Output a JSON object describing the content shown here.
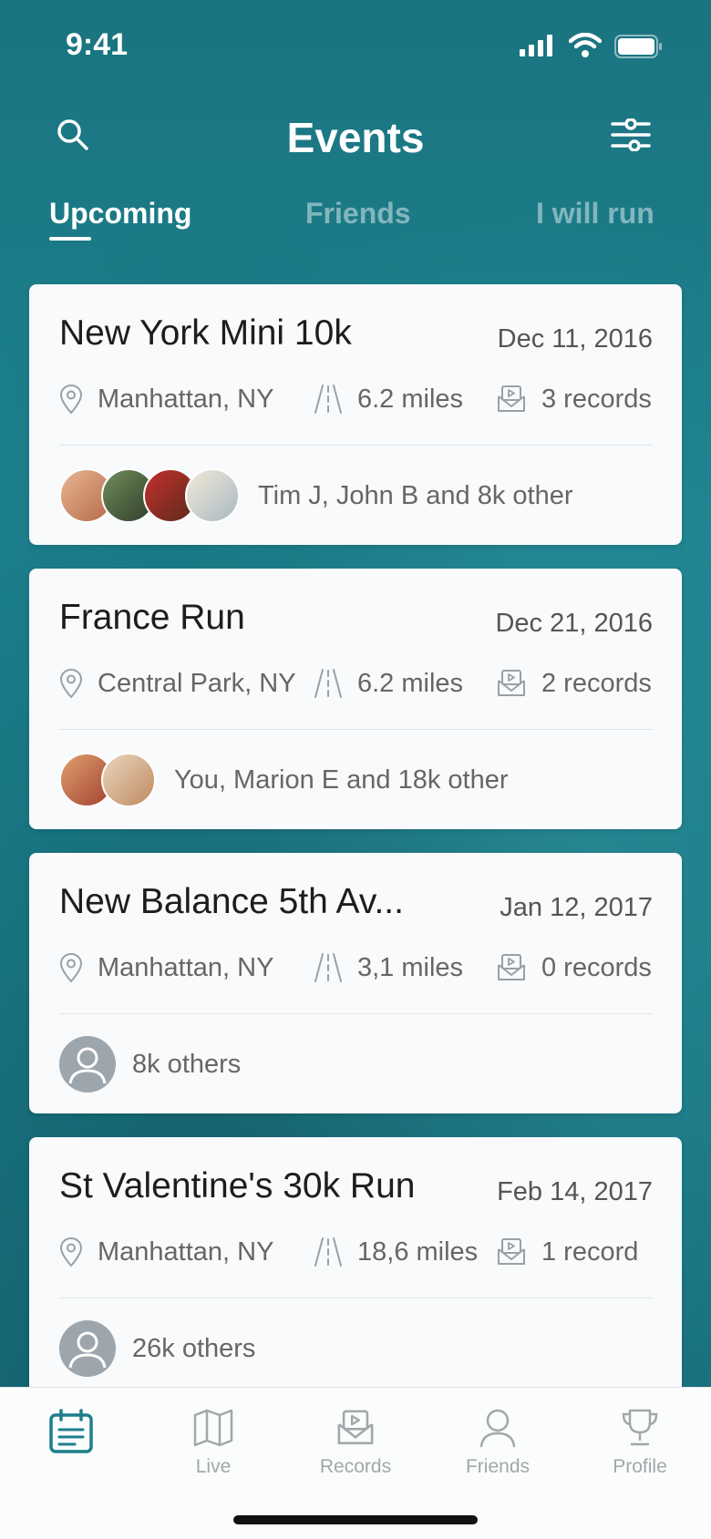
{
  "status_bar": {
    "time": "9:41"
  },
  "header": {
    "title": "Events"
  },
  "tabs": [
    {
      "label": "Upcoming",
      "active": true
    },
    {
      "label": "Friends",
      "active": false
    },
    {
      "label": "I will run",
      "active": false
    }
  ],
  "events": [
    {
      "name": "New York Mini 10k",
      "date": "Dec 11, 2016",
      "location": "Manhattan, NY",
      "distance": "6.2 miles",
      "records": "3 records",
      "attendees": "Tim J, John B and 8k other"
    },
    {
      "name": "France Run",
      "date": "Dec 21, 2016",
      "location": "Central Park, NY",
      "distance": "6.2 miles",
      "records": "2 records",
      "attendees": "You, Marion E and 18k other"
    },
    {
      "name": "New Balance 5th Av...",
      "date": "Jan 12, 2017",
      "location": "Manhattan, NY",
      "distance": "3,1 miles",
      "records": "0 records",
      "attendees": "8k others"
    },
    {
      "name": "St Valentine's 30k Run",
      "date": "Feb 14, 2017",
      "location": "Manhattan, NY",
      "distance": "18,6 miles",
      "records": "1 record",
      "attendees": "26k others"
    }
  ],
  "tabbar": {
    "items": [
      {
        "label": "",
        "icon": "calendar-icon",
        "active": true
      },
      {
        "label": "Live",
        "icon": "map-icon",
        "active": false
      },
      {
        "label": "Records",
        "icon": "records-icon",
        "active": false
      },
      {
        "label": "Friends",
        "icon": "person-icon",
        "active": false
      },
      {
        "label": "Profile",
        "icon": "trophy-icon",
        "active": false
      }
    ]
  },
  "colors": {
    "accent": "#1d7f8b",
    "inactive": "#a3a7aa",
    "text": "#1d1d1d"
  }
}
